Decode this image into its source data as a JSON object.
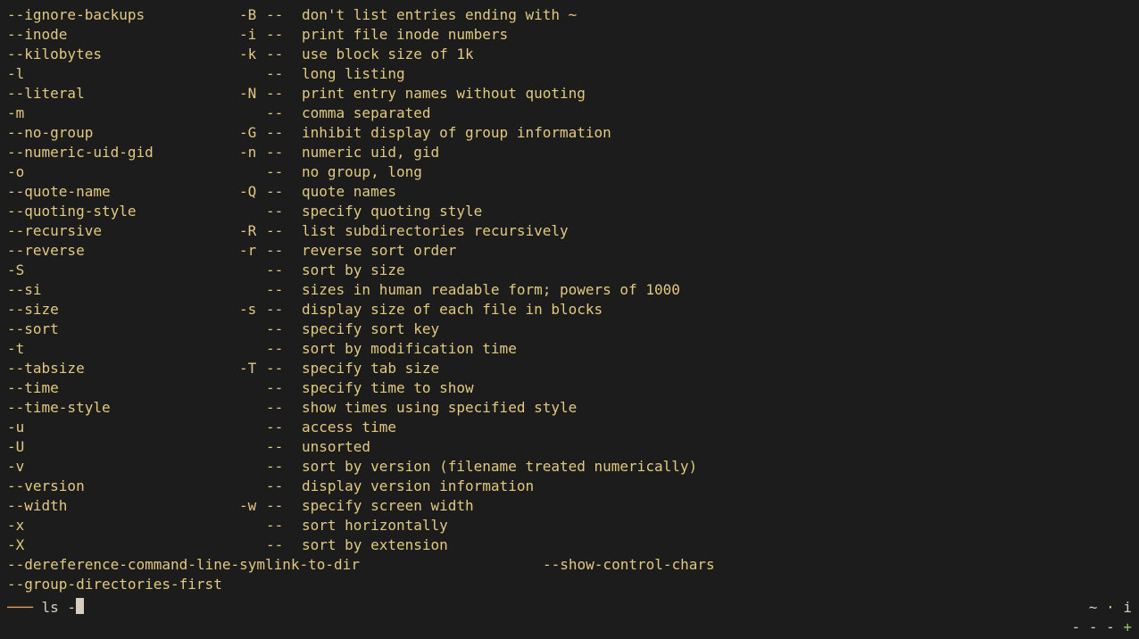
{
  "completions": [
    {
      "long": "--ignore-backups",
      "short": "-B",
      "desc": "don't list entries ending with ~"
    },
    {
      "long": "--inode",
      "short": "-i",
      "desc": "print file inode numbers"
    },
    {
      "long": "--kilobytes",
      "short": "-k",
      "desc": "use block size of 1k"
    },
    {
      "long": "-l",
      "short": "",
      "desc": "long listing"
    },
    {
      "long": "--literal",
      "short": "-N",
      "desc": "print entry names without quoting"
    },
    {
      "long": "-m",
      "short": "",
      "desc": "comma separated"
    },
    {
      "long": "--no-group",
      "short": "-G",
      "desc": "inhibit display of group information"
    },
    {
      "long": "--numeric-uid-gid",
      "short": "-n",
      "desc": "numeric uid, gid"
    },
    {
      "long": "-o",
      "short": "",
      "desc": "no group, long"
    },
    {
      "long": "--quote-name",
      "short": "-Q",
      "desc": "quote names"
    },
    {
      "long": "--quoting-style",
      "short": "",
      "desc": "specify quoting style"
    },
    {
      "long": "--recursive",
      "short": "-R",
      "desc": "list subdirectories recursively"
    },
    {
      "long": "--reverse",
      "short": "-r",
      "desc": "reverse sort order"
    },
    {
      "long": "-S",
      "short": "",
      "desc": "sort by size"
    },
    {
      "long": "--si",
      "short": "",
      "desc": "sizes in human readable form; powers of 1000"
    },
    {
      "long": "--size",
      "short": "-s",
      "desc": "display size of each file in blocks"
    },
    {
      "long": "--sort",
      "short": "",
      "desc": "specify sort key"
    },
    {
      "long": "-t",
      "short": "",
      "desc": "sort by modification time"
    },
    {
      "long": "--tabsize",
      "short": "-T",
      "desc": "specify tab size"
    },
    {
      "long": "--time",
      "short": "",
      "desc": "specify time to show"
    },
    {
      "long": "--time-style",
      "short": "",
      "desc": "show times using specified style"
    },
    {
      "long": "-u",
      "short": "",
      "desc": "access time"
    },
    {
      "long": "-U",
      "short": "",
      "desc": "unsorted"
    },
    {
      "long": "-v",
      "short": "",
      "desc": "sort by version (filename treated numerically)"
    },
    {
      "long": "--version",
      "short": "",
      "desc": "display version information"
    },
    {
      "long": "--width",
      "short": "-w",
      "desc": "specify screen width"
    },
    {
      "long": "-x",
      "short": "",
      "desc": "sort horizontally"
    },
    {
      "long": "-X",
      "short": "",
      "desc": "sort by extension"
    }
  ],
  "extra_completions": {
    "col1": [
      "--dereference-command-line-symlink-to-dir",
      "--group-directories-first"
    ],
    "col2": [
      "--show-control-chars"
    ]
  },
  "prompt": {
    "decoration": "─── ",
    "command": "ls -",
    "cwd": "~",
    "separator": "·",
    "mode": "i"
  },
  "bottom": {
    "dashes": "- - -",
    "plus": "+"
  },
  "sep": "--"
}
